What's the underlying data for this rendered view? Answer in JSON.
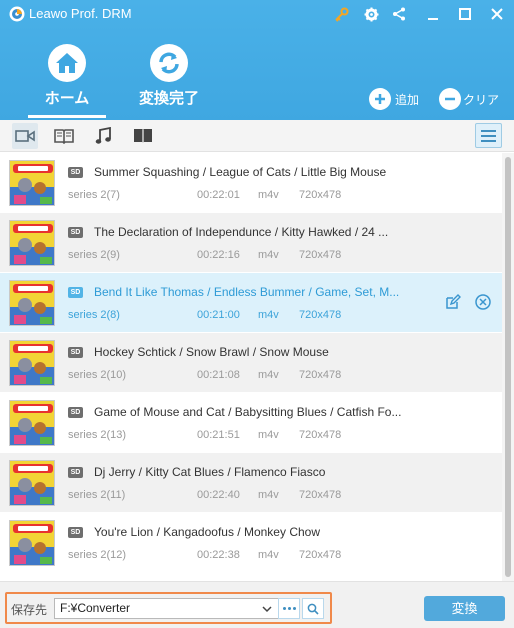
{
  "app": {
    "title": "Leawo Prof. DRM"
  },
  "window_controls": {
    "icons": [
      "key-icon",
      "gear-icon",
      "share-icon",
      "minimize-icon",
      "maximize-icon",
      "close-icon"
    ],
    "key_color": "#f5a623"
  },
  "nav": {
    "home_label": "ホーム",
    "converted_label": "変換完了"
  },
  "actions": {
    "add_label": "追加",
    "clear_label": "クリア"
  },
  "toolbar": {
    "tabs": [
      "video-icon",
      "book-icon",
      "music-icon",
      "audiobook-icon"
    ],
    "active_tab": "video-icon"
  },
  "items": [
    {
      "badge": "SD",
      "title": "Summer Squashing / League of Cats / Little Big Mouse",
      "series": "series 2(7)",
      "duration": "00:22:01",
      "format": "m4v",
      "resolution": "720x478"
    },
    {
      "badge": "SD",
      "title": "The Declaration of Independunce / Kitty Hawked / 24 ...",
      "series": "series 2(9)",
      "duration": "00:22:16",
      "format": "m4v",
      "resolution": "720x478"
    },
    {
      "badge": "SD",
      "title": "Bend It Like Thomas / Endless Bummer / Game, Set, M...",
      "series": "series 2(8)",
      "duration": "00:21:00",
      "format": "m4v",
      "resolution": "720x478"
    },
    {
      "badge": "SD",
      "title": "Hockey Schtick / Snow Brawl / Snow Mouse",
      "series": "series 2(10)",
      "duration": "00:21:08",
      "format": "m4v",
      "resolution": "720x478"
    },
    {
      "badge": "SD",
      "title": "Game of Mouse and Cat / Babysitting Blues / Catfish Fo...",
      "series": "series 2(13)",
      "duration": "00:21:51",
      "format": "m4v",
      "resolution": "720x478"
    },
    {
      "badge": "SD",
      "title": "Dj Jerry / Kitty Cat Blues / Flamenco Fiasco",
      "series": "series 2(11)",
      "duration": "00:22:40",
      "format": "m4v",
      "resolution": "720x478"
    },
    {
      "badge": "SD",
      "title": "You're Lion / Kangadoofus / Monkey Chow",
      "series": "series 2(12)",
      "duration": "00:22:38",
      "format": "m4v",
      "resolution": "720x478"
    }
  ],
  "selected_index": 2,
  "footer": {
    "save_label": "保存先",
    "path_value": "F:¥Converter",
    "convert_label": "変換"
  },
  "colors": {
    "header_blue": "#45aee6",
    "selected_row": "#dcf1fb",
    "selected_text": "#2e9bd6",
    "highlight_border": "#f0894a",
    "convert_button": "#52a9dc"
  }
}
